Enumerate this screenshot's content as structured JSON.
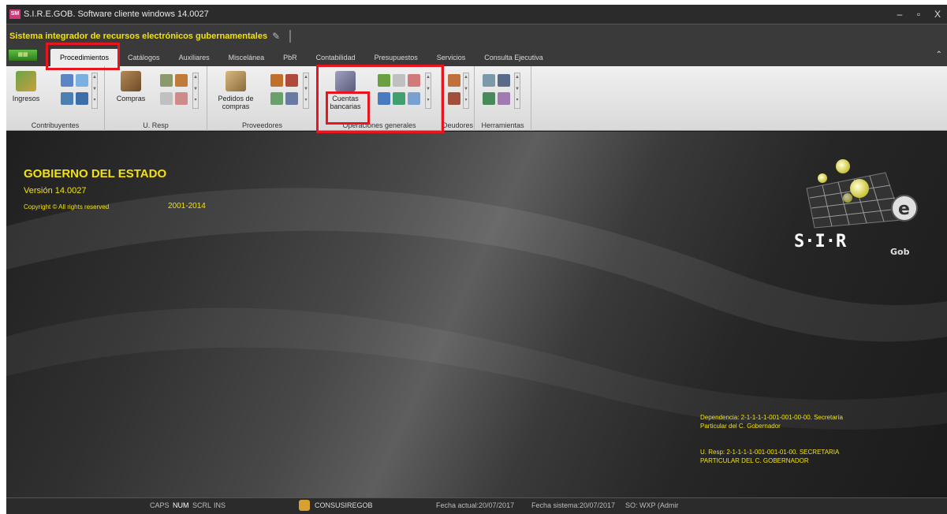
{
  "window": {
    "title": "S.I.R.E.GOB. Software cliente windows 14.0027",
    "app_icon_text": "SM",
    "minimize": "–",
    "restore": "▫",
    "close": "X"
  },
  "system": {
    "name": "Sistema integrador de recursos electrónicos gubernamentales"
  },
  "tabs": [
    "Procedimientos",
    "Catálogos",
    "Auxiliares",
    "Miscelánea",
    "PbR",
    "Contabilidad",
    "Presupuestos",
    "Servicios",
    "Consulta Ejecutiva"
  ],
  "ribbon": {
    "groups": {
      "contribuyentes": {
        "label": "Contribuyentes",
        "button": "Ingresos"
      },
      "uresp": {
        "label": "U. Resp",
        "button": "Compras"
      },
      "proveedores": {
        "label": "Proveedores",
        "button_line1": "Pedidos de",
        "button_line2": "compras"
      },
      "operaciones": {
        "label": "Operaciones generales",
        "button_line1": "Cuentas",
        "button_line2": "bancarias"
      },
      "deudores": {
        "label": "Deudores"
      },
      "herramientas": {
        "label": "Herramientas"
      }
    }
  },
  "splash": {
    "heading": "GOBIERNO DEL ESTADO",
    "version": "Versión 14.0027",
    "copyright": "Copyright ©  All rights reserved",
    "years": "2001-2014",
    "dependencia_line1": "Dependencia: 2-1-1-1-1-001-001-00-00. Secretaría",
    "dependencia_line2": "Particular del C. Gobernador",
    "uresp_line1": "U. Resp: 2-1-1-1-1-001-001-01-00. SECRETARIA",
    "uresp_line2": "PARTICULAR DEL C. GOBERNADOR",
    "logo_text": "S·I·R",
    "logo_sub": "Gob",
    "logo_e": "e"
  },
  "statusbar": {
    "caps": "CAPS",
    "num": "NUM",
    "scrl": "SCRL",
    "ins": "INS",
    "user": "CONSUSIREGOB",
    "fecha_actual": "Fecha actual:20/07/2017",
    "fecha_sistema": "Fecha sistema:20/07/2017",
    "so": "SO: WXP (Admir"
  },
  "colors": {
    "accent_yellow": "#f2e20a",
    "highlight_red": "#e8141e"
  }
}
